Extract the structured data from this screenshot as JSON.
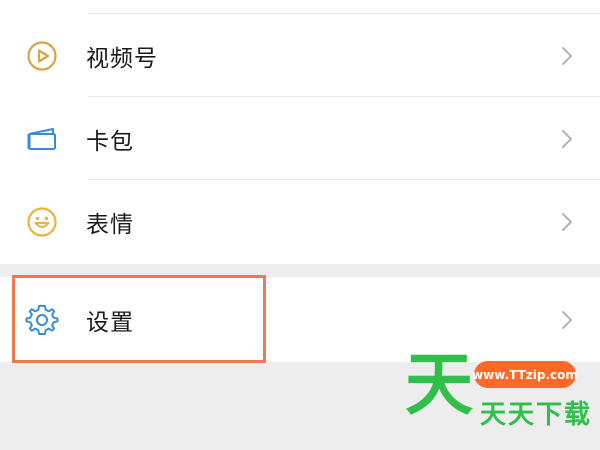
{
  "menu": {
    "items": [
      {
        "label": "视频号",
        "icon": "video-channel-icon",
        "color": "#d9a441"
      },
      {
        "label": "卡包",
        "icon": "card-wallet-icon",
        "color": "#3b8ad8"
      },
      {
        "label": "表情",
        "icon": "sticker-smiley-icon",
        "color": "#e9b43c"
      }
    ],
    "settings": {
      "label": "设置",
      "icon": "settings-gear-icon",
      "color": "#3b8ad8"
    }
  },
  "highlight": {
    "color": "#ef7a52"
  },
  "watermark": {
    "big_char": "天",
    "url": "www.TTzip.com",
    "text": "天天下载",
    "green": "#2fbf4a",
    "orange": "#ff6a2a"
  }
}
